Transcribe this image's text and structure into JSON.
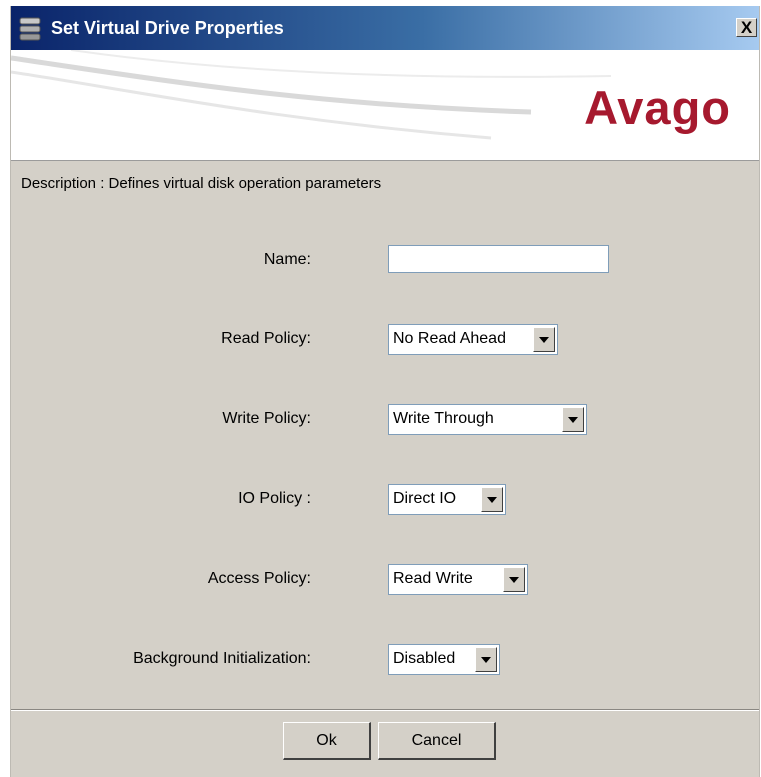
{
  "window": {
    "title": "Set Virtual Drive Properties",
    "close_label": "X",
    "icon": "database-icon"
  },
  "banner": {
    "logo_text": "Avago"
  },
  "description": "Description : Defines virtual disk operation parameters",
  "fields": {
    "name": {
      "label": "Name:",
      "value": ""
    },
    "read_policy": {
      "label": "Read Policy:",
      "value": "No Read Ahead"
    },
    "write_policy": {
      "label": "Write Policy:",
      "value": "Write Through"
    },
    "io_policy": {
      "label": "IO Policy :",
      "value": "Direct IO"
    },
    "access_policy": {
      "label": "Access Policy:",
      "value": "Read Write"
    },
    "background_init": {
      "label": "Background Initialization:",
      "value": "Disabled"
    }
  },
  "buttons": {
    "ok": "Ok",
    "cancel": "Cancel"
  },
  "colors": {
    "logo": "#a6192e",
    "dialog_bg": "#d4d0c8",
    "titlebar": "#0a246a"
  }
}
